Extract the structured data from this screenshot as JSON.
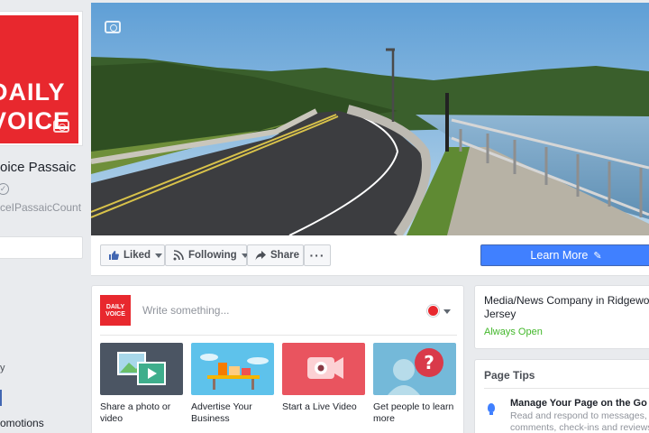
{
  "brand": {
    "accent": "#e8282e",
    "primary": "#4080ff",
    "logo_line1": "DAILY",
    "logo_line2": "VOICE"
  },
  "page": {
    "name": "oice Passaic",
    "handle": "ceIPassaicCount",
    "left_fragment": "y",
    "promotions": "omotions"
  },
  "actions": {
    "liked": "Liked",
    "following": "Following",
    "share": "Share",
    "more": "···",
    "cta": "Learn More"
  },
  "composer": {
    "placeholder": "Write something...",
    "logo_text": "DAILY VOICE",
    "tiles": [
      {
        "label": "Share a photo or video",
        "icon": "photo-video-icon"
      },
      {
        "label": "Advertise Your Business",
        "icon": "storefront-icon"
      },
      {
        "label": "Start a Live Video",
        "icon": "live-video-icon"
      },
      {
        "label": "Get people to learn more",
        "icon": "question-person-icon"
      }
    ]
  },
  "about": {
    "category": "Media/News Company in Ridgewoo",
    "category_line2": "Jersey",
    "hours": "Always Open"
  },
  "tips": {
    "title": "Page Tips",
    "item_title": "Manage Your Page on the Go",
    "item_body": "Read and respond to messages, comments, check-ins and reviews i"
  }
}
